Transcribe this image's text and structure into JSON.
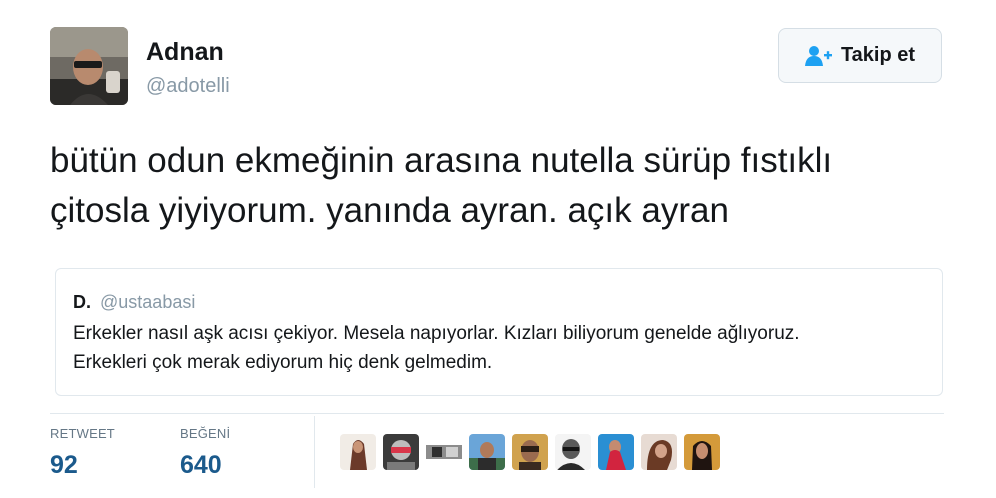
{
  "user": {
    "name": "Adnan",
    "handle": "@adotelli",
    "avatar_icon": "user-avatar-photo"
  },
  "follow_button": {
    "label": "Takip et",
    "icon": "add-user-icon",
    "accent": "#1da1f2"
  },
  "tweet": {
    "lines": [
      "bütün odun ekmeğinin arasına nutella sürüp fıstıklı",
      "çitosla yiyiyorum. yanında ayran. açık ayran"
    ]
  },
  "quoted_tweet": {
    "name": "D.",
    "handle": "@ustaabasi",
    "lines": [
      "Erkekler nasıl aşk acısı çekiyor. Mesela napıyorlar. Kızları biliyorum genelde ağlıyoruz.",
      "Erkekleri çok merak ediyorum hiç denk gelmedim."
    ]
  },
  "stats": {
    "retweet_label": "RETWEET",
    "retweet_count": "92",
    "like_label": "BEĞENİ",
    "like_count": "640",
    "count_color": "#1b5a8c"
  },
  "likers": [
    {
      "icon": "liker-avatar-1"
    },
    {
      "icon": "liker-avatar-2"
    },
    {
      "icon": "liker-avatar-3"
    },
    {
      "icon": "liker-avatar-4"
    },
    {
      "icon": "liker-avatar-5"
    },
    {
      "icon": "liker-avatar-6"
    },
    {
      "icon": "liker-avatar-7"
    },
    {
      "icon": "liker-avatar-8"
    },
    {
      "icon": "liker-avatar-9"
    }
  ]
}
